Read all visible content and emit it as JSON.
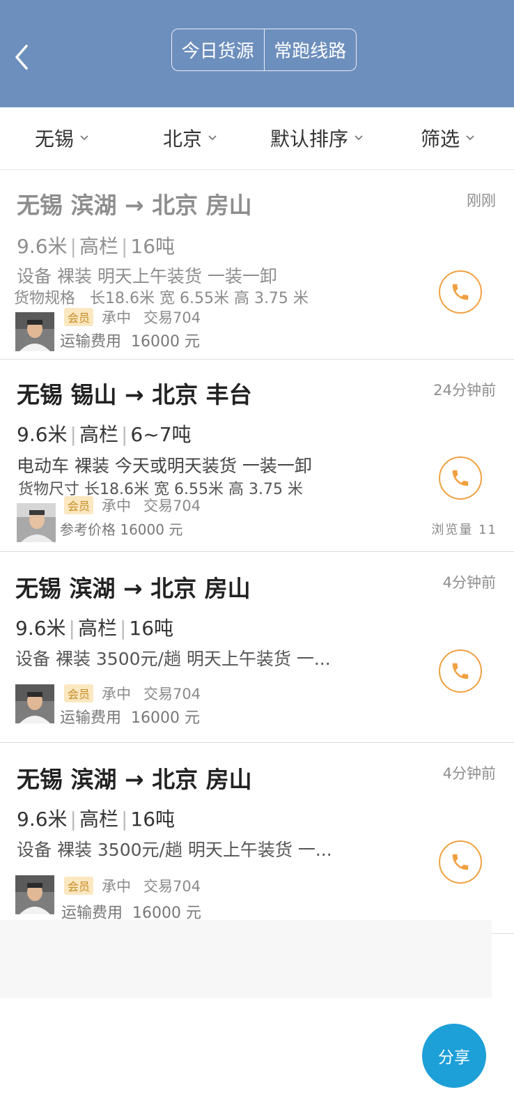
{
  "header": {
    "tabs": [
      "今日货源",
      "常跑线路"
    ]
  },
  "filters": {
    "origin": "无锡",
    "destination": "北京",
    "sort": "默认排序",
    "filter": "筛选"
  },
  "cards": [
    {
      "route": "无锡 滨湖 → 北京 房山",
      "time": "刚刚",
      "length": "9.6米",
      "truck_type": "高栏",
      "weight": "16吨",
      "description": "设备 裸装 明天上午装货 一装一卸",
      "size_label": "货物规格",
      "size": "长18.6米 宽 6.55米 高 3.75 米",
      "member_badge": "会员",
      "company": "承中",
      "trades": "交易704",
      "price_label": "运输费用",
      "price": "16000 元",
      "faded": true
    },
    {
      "route": "无锡 锡山 → 北京 丰台",
      "time": "24分钟前",
      "length": "9.6米",
      "truck_type": "高栏",
      "weight": "6~7吨",
      "description": "电动车 裸装 今天或明天装货 一装一卸",
      "size_label": "货物尺寸",
      "size": "长18.6米 宽 6.55米 高 3.75 米",
      "member_badge": "会员",
      "company": "承中",
      "trades": "交易704",
      "price_label": "参考价格",
      "price": "16000 元",
      "views": "浏览量 11"
    },
    {
      "route": "无锡 滨湖 → 北京 房山",
      "time": "4分钟前",
      "length": "9.6米",
      "truck_type": "高栏",
      "weight": "16吨",
      "description": "设备 裸装 3500元/趟 明天上午装货 一...",
      "member_badge": "会员",
      "company": "承中",
      "trades": "交易704",
      "price_label": "运输费用",
      "price": "16000 元"
    },
    {
      "route": "无锡 滨湖 → 北京 房山",
      "time": "4分钟前",
      "length": "9.6米",
      "truck_type": "高栏",
      "weight": "16吨",
      "description": "设备 裸装 3500元/趟 明天上午装货 一...",
      "member_badge": "会员",
      "company": "承中",
      "trades": "交易704",
      "price_label": "运输费用",
      "price": "16000 元"
    }
  ],
  "share_button": "分享",
  "icons": {
    "back": "chevron-left-icon",
    "dropdown": "chevron-down-icon",
    "phone": "phone-icon"
  },
  "colors": {
    "header_bg": "#6d8fbd",
    "phone_accent": "#f0a040",
    "share_bg": "#1d9fd8",
    "badge_bg": "#fbe7c0"
  }
}
